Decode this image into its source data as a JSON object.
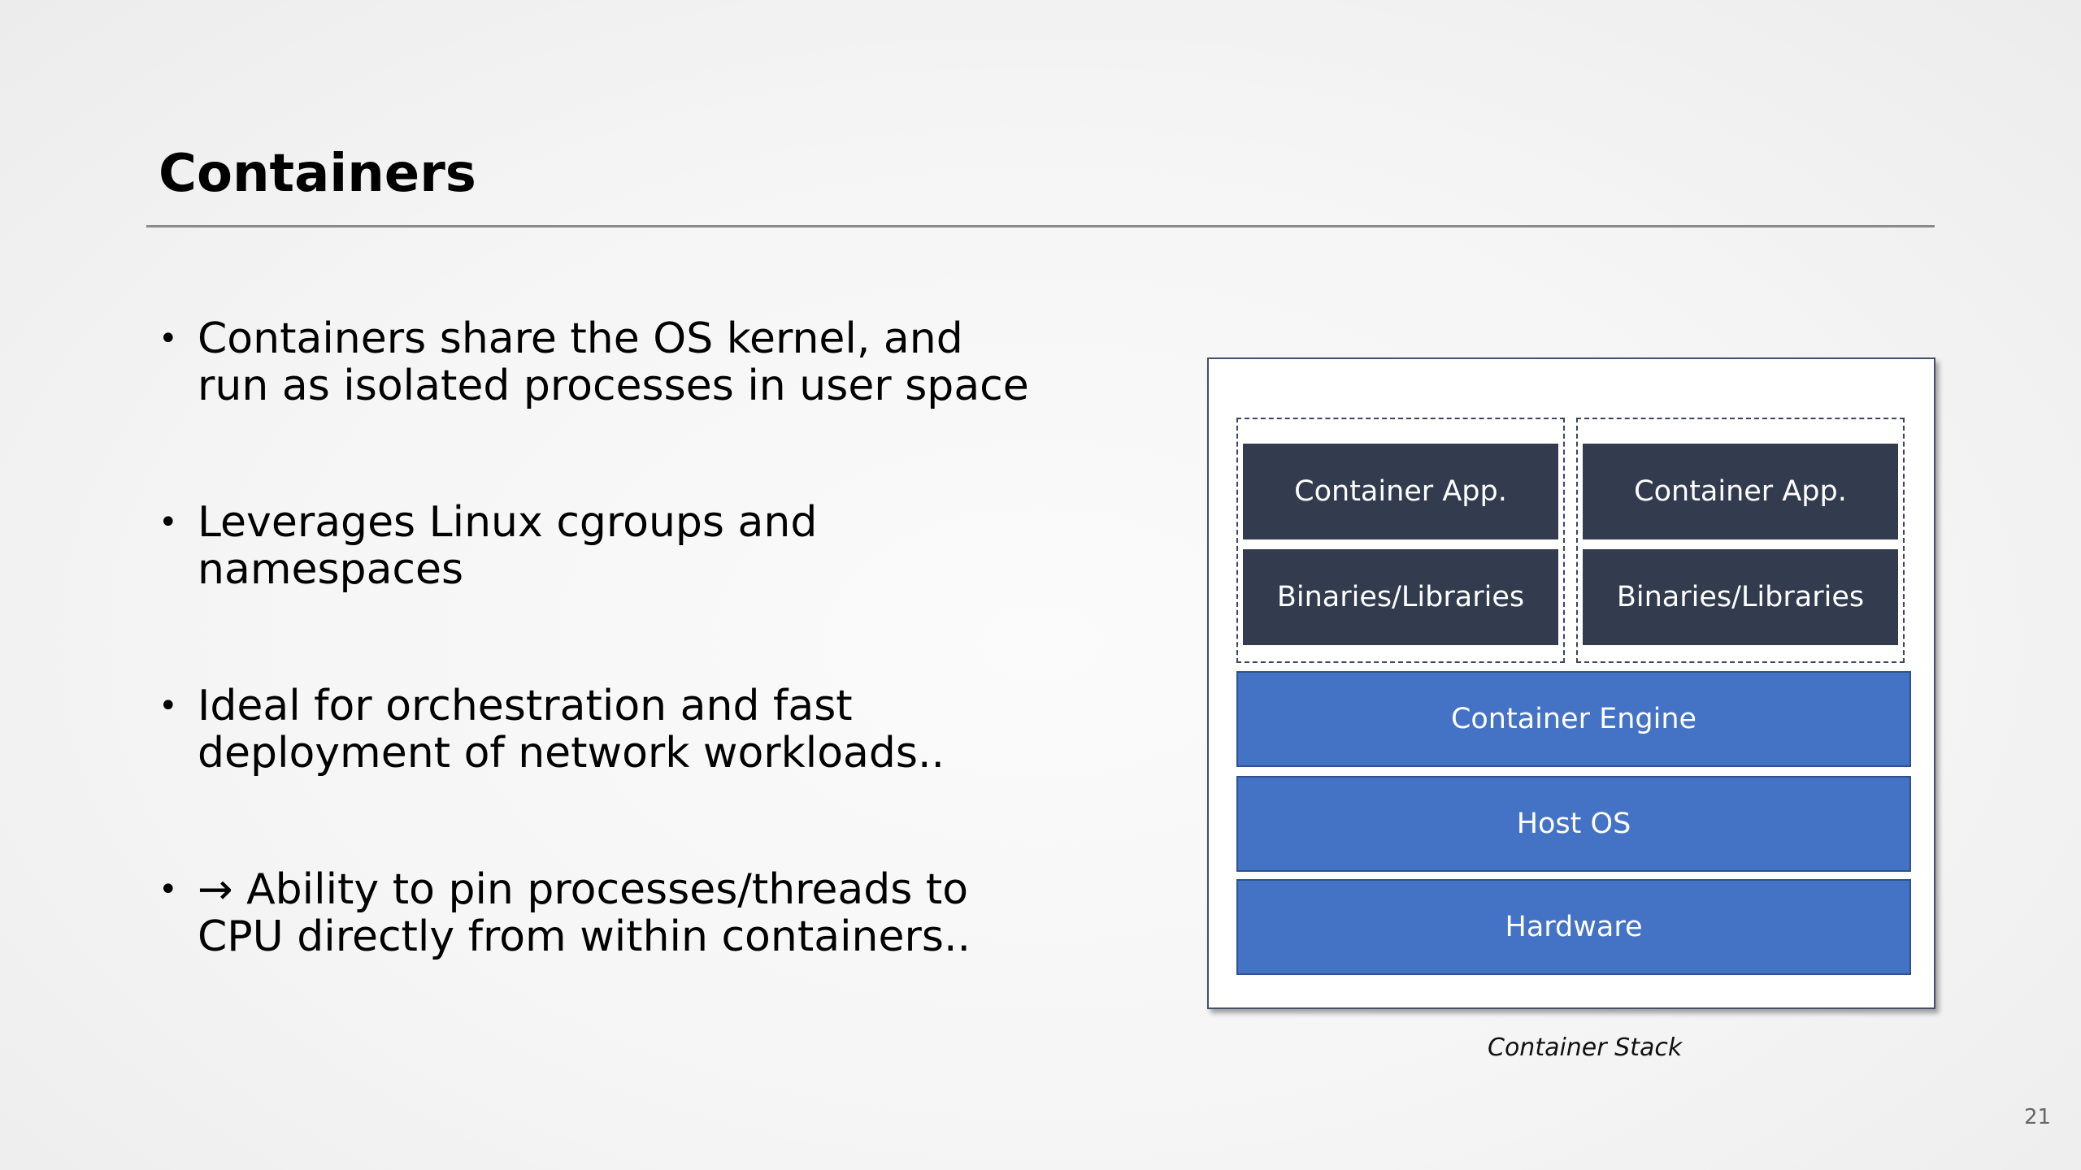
{
  "slide": {
    "title": "Containers",
    "page_number": "21"
  },
  "bullets": [
    {
      "marker": "•",
      "text": "Containers share the OS kernel, and\nrun as isolated processes in user space"
    },
    {
      "marker": "•",
      "text": "Leverages Linux cgroups and\nnamespaces"
    },
    {
      "marker": "•",
      "text": "Ideal for orchestration and fast\ndeployment of network workloads.."
    },
    {
      "marker": "•",
      "text": "→ Ability to pin processes/threads to\nCPU directly from within containers.."
    }
  ],
  "diagram": {
    "caption": "Container Stack",
    "containers": [
      {
        "app": "Container App.",
        "libs": "Binaries/Libraries"
      },
      {
        "app": "Container App.",
        "libs": "Binaries/Libraries"
      }
    ],
    "layers": {
      "engine": "Container Engine",
      "host_os": "Host OS",
      "hardware": "Hardware"
    },
    "colors": {
      "container_layer": "#323c4e",
      "platform_layer": "#4472c4",
      "platform_border": "#2f528f",
      "frame_border": "#44506a"
    }
  }
}
